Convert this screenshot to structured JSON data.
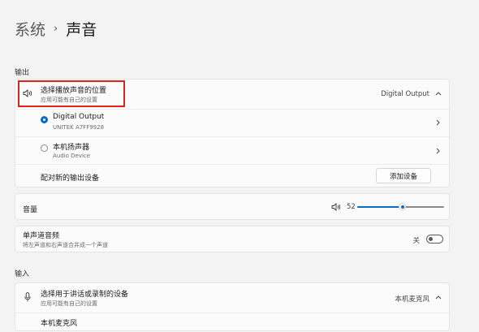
{
  "breadcrumb": {
    "parent": "系统",
    "separator": "›",
    "current": "声音"
  },
  "output": {
    "section_label": "输出",
    "choose_device": {
      "title": "选择播放声音的位置",
      "subtitle": "应用可能有自己的设置",
      "selected": "Digital Output",
      "chevron": "^",
      "icon": "speaker-icon"
    },
    "devices": [
      {
        "name": "Digital Output",
        "detail": "UNITEK A7FF9928",
        "selected": true
      },
      {
        "name": "本机扬声器",
        "detail": "Audio Device",
        "selected": false
      }
    ],
    "pair_label": "配对新的输出设备",
    "add_button": "添加设备"
  },
  "volume": {
    "label": "音量",
    "value": "52",
    "level": 52,
    "icon": "speaker-icon"
  },
  "mono": {
    "title": "单声道音频",
    "subtitle": "将左声道和右声道合并成一个声道",
    "state": "关",
    "on": false
  },
  "input": {
    "section_label": "输入",
    "choose_device": {
      "title": "选择用于讲话或录制的设备",
      "subtitle": "应用可能有自己的设置",
      "selected": "本机麦克风",
      "chevron": "^",
      "icon": "microphone-icon"
    },
    "devices": [
      {
        "name": "本机麦克风"
      }
    ]
  },
  "colors": {
    "accent": "#0a6bc4",
    "highlight": "#d9261c"
  }
}
